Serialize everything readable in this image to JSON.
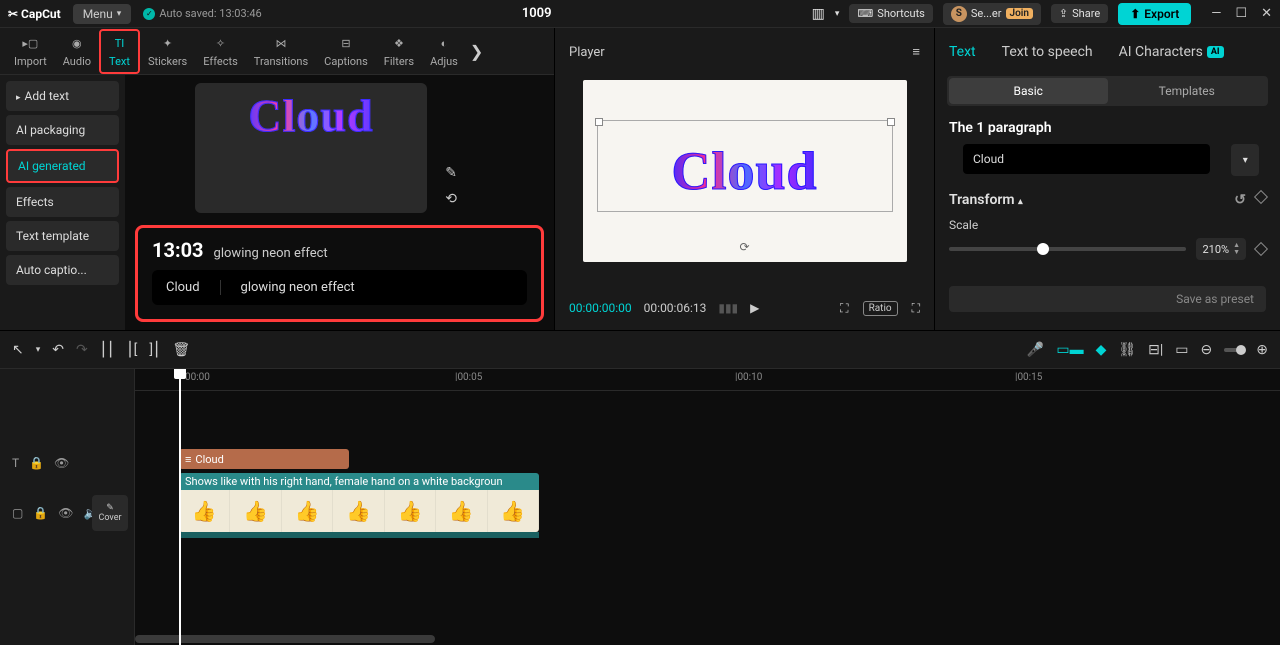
{
  "titlebar": {
    "logo": "CapCut",
    "menu": "Menu",
    "autosave": "Auto saved: 13:03:46",
    "project": "1009",
    "user_initial": "S",
    "user": "Se...er",
    "join": "Join",
    "shortcuts": "Shortcuts",
    "share": "Share",
    "export": "Export"
  },
  "tool_tabs": {
    "import": "Import",
    "audio": "Audio",
    "text": "Text",
    "stickers": "Stickers",
    "effects": "Effects",
    "transitions": "Transitions",
    "captions": "Captions",
    "filters": "Filters",
    "adjust": "Adjus"
  },
  "sidebar": {
    "add_text": "Add text",
    "ai_packaging": "AI packaging",
    "ai_generated": "AI generated",
    "effects": "Effects",
    "text_template": "Text template",
    "auto_captions": "Auto captio..."
  },
  "gen": {
    "time": "13:03",
    "desc": "glowing neon effect",
    "field_a": "Cloud",
    "field_b": "glowing neon effect"
  },
  "player": {
    "title": "Player",
    "canvas_text": "Cloud",
    "tc_start": "00:00:00:00",
    "tc_end": "00:00:06:13",
    "ratio": "Ratio"
  },
  "inspector": {
    "tab_text": "Text",
    "tab_tts": "Text to speech",
    "tab_ai": "AI Characters",
    "sub_basic": "Basic",
    "sub_templates": "Templates",
    "para_label": "The 1 paragraph",
    "text_value": "Cloud",
    "transform": "Transform",
    "scale_label": "Scale",
    "scale_value": "210%",
    "save_preset": "Save as preset"
  },
  "ruler": {
    "t0": "00:00",
    "t5": "|00:05",
    "t10": "|00:10",
    "t15": "|00:15"
  },
  "tracks": {
    "text_clip": "Cloud",
    "video_label": "Shows like with his right hand, female hand on a white backgroun",
    "cover": "Cover"
  }
}
